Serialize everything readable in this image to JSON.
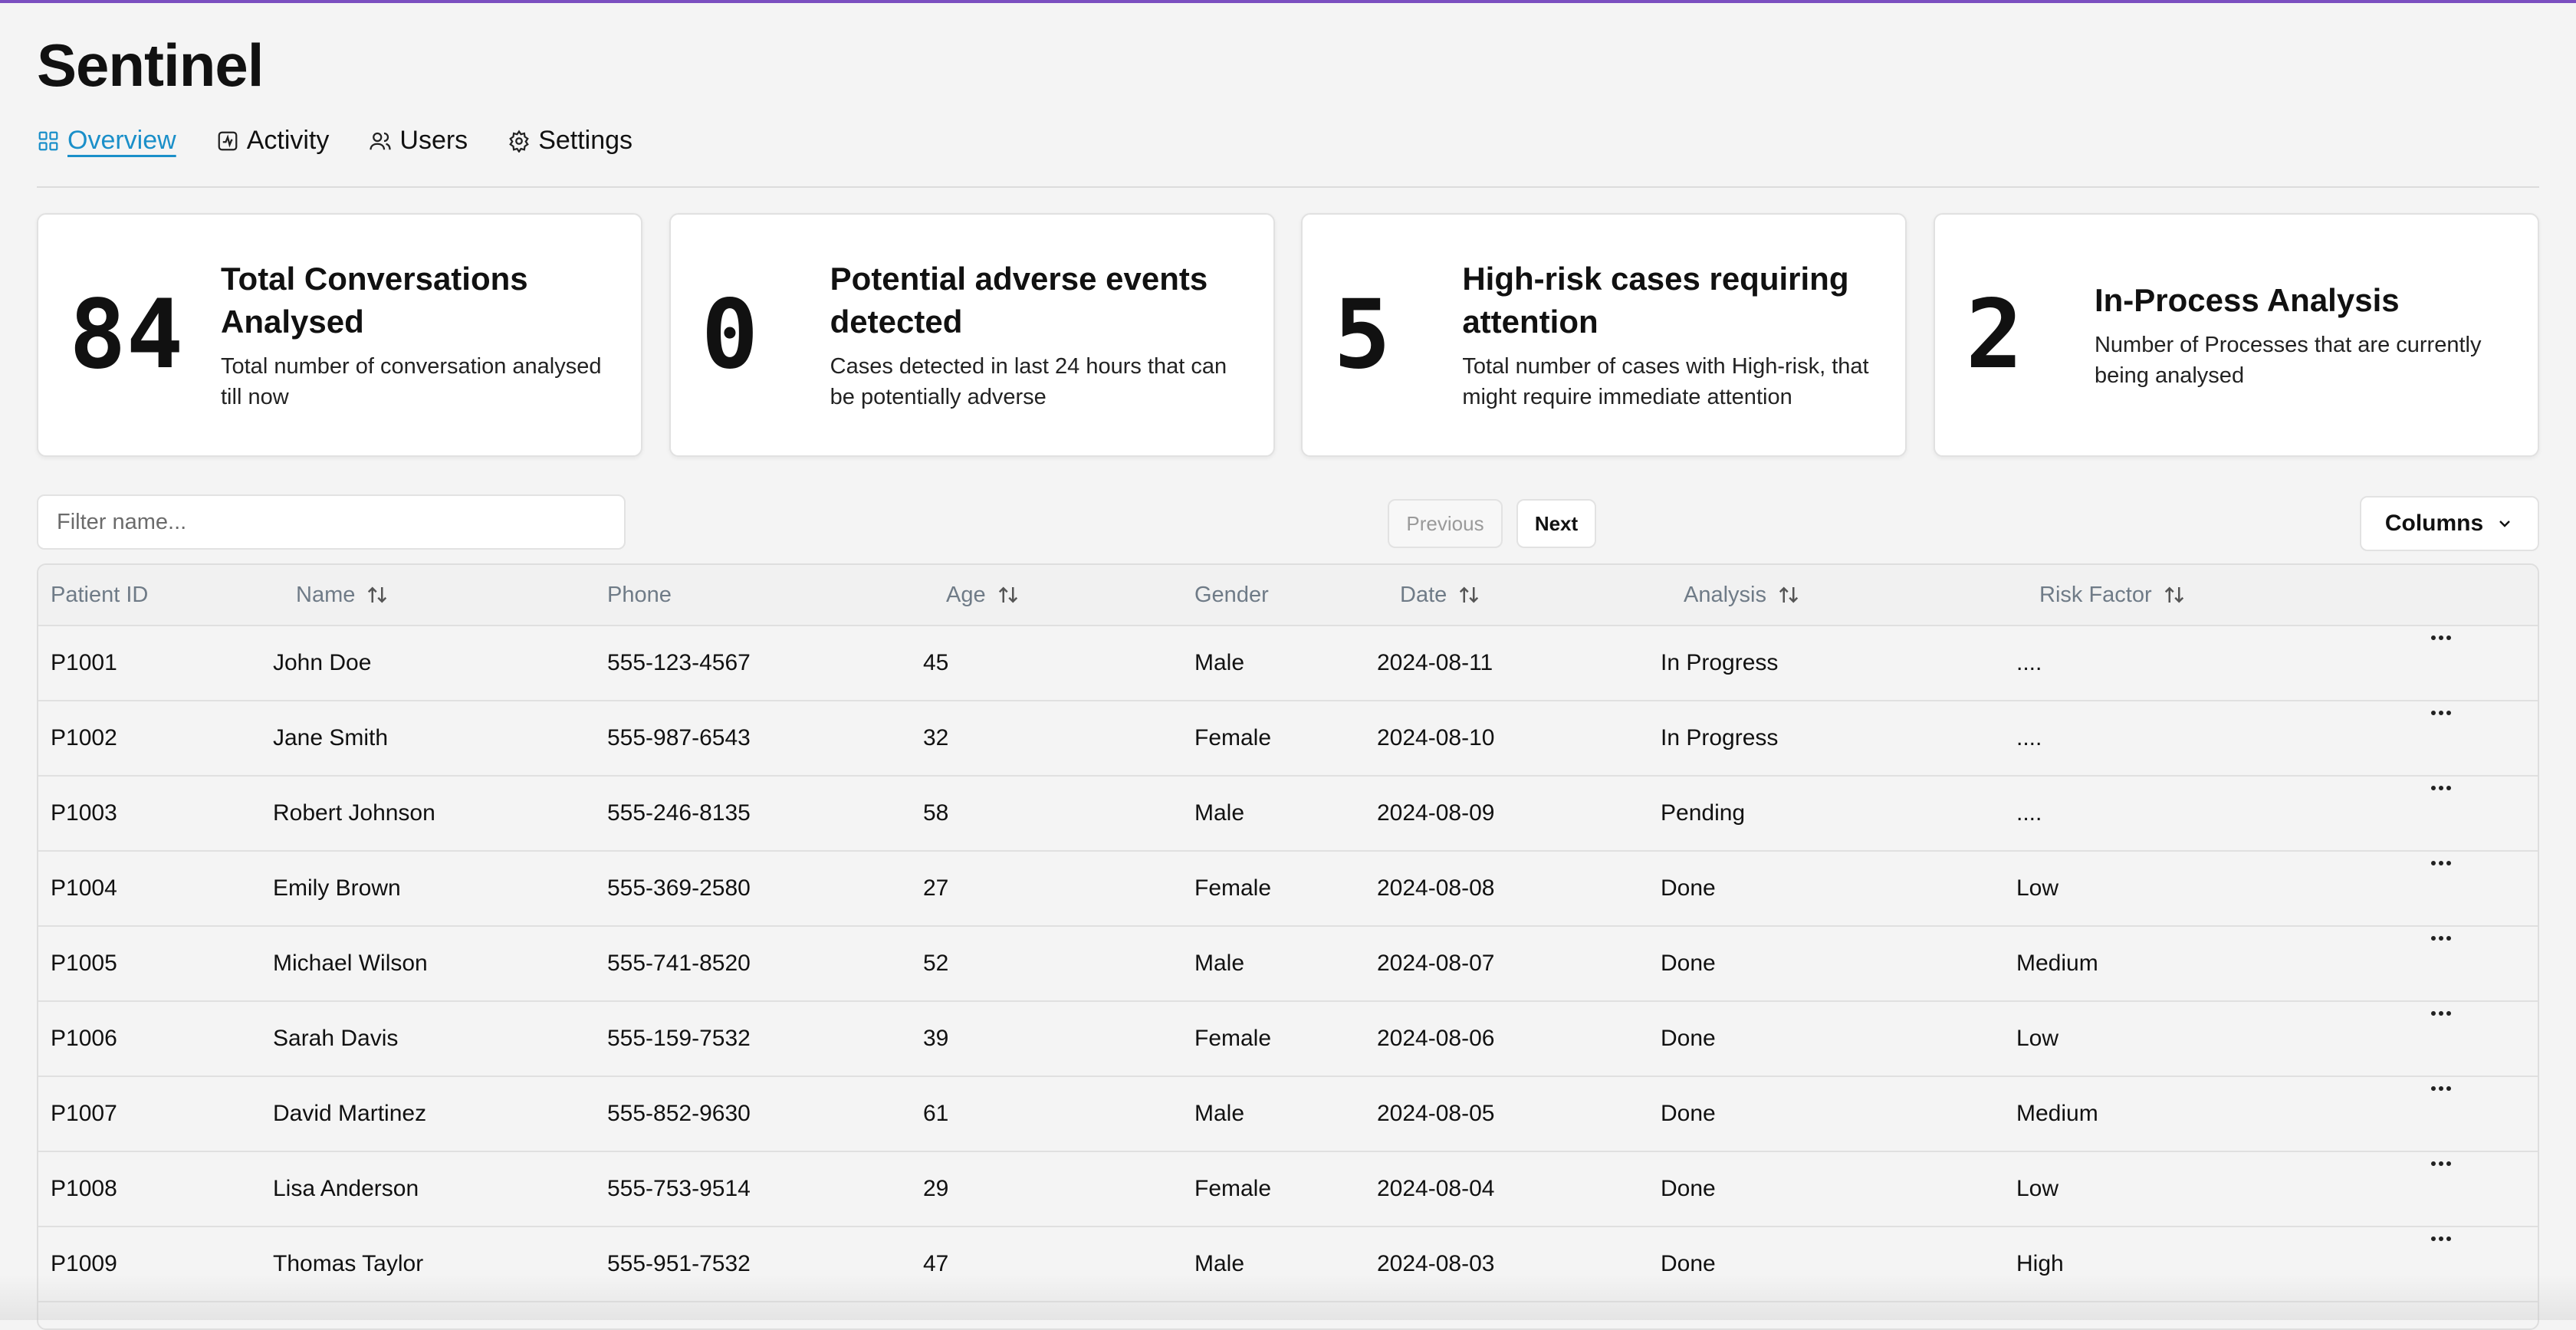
{
  "app": {
    "title": "Sentinel",
    "accent_color": "#1a8fc9",
    "top_bar_color": "#7b4fc0"
  },
  "tabs": [
    {
      "label": "Overview",
      "icon": "grid-icon",
      "active": true
    },
    {
      "label": "Activity",
      "icon": "activity-icon",
      "active": false
    },
    {
      "label": "Users",
      "icon": "users-icon",
      "active": false
    },
    {
      "label": "Settings",
      "icon": "gear-icon",
      "active": false
    }
  ],
  "cards": [
    {
      "value": "84",
      "title": "Total Conversations Analysed",
      "desc": "Total number of conversation analysed till now"
    },
    {
      "value": "0",
      "title": "Potential adverse events detected",
      "desc": "Cases detected in last 24 hours that can be potentially adverse"
    },
    {
      "value": "5",
      "title": "High-risk cases requiring attention",
      "desc": "Total number of cases with High-risk, that might require immediate attention"
    },
    {
      "value": "2",
      "title": "In-Process Analysis",
      "desc": "Number of Processes that are currently being analysed"
    }
  ],
  "filter": {
    "placeholder": "Filter name...",
    "value": ""
  },
  "pagination": {
    "previous_label": "Previous",
    "next_label": "Next"
  },
  "columns_button": {
    "label": "Columns",
    "icon": "chevron-down-icon"
  },
  "table": {
    "headers": [
      "Patient ID",
      "Name",
      "Phone",
      "Age",
      "Gender",
      "Date",
      "Analysis",
      "Risk Factor"
    ],
    "sortable": [
      false,
      true,
      false,
      true,
      false,
      true,
      true,
      true
    ],
    "rows": [
      [
        "P1001",
        "John Doe",
        "555-123-4567",
        "45",
        "Male",
        "2024-08-11",
        "In Progress",
        "...."
      ],
      [
        "P1002",
        "Jane Smith",
        "555-987-6543",
        "32",
        "Female",
        "2024-08-10",
        "In Progress",
        "...."
      ],
      [
        "P1003",
        "Robert Johnson",
        "555-246-8135",
        "58",
        "Male",
        "2024-08-09",
        "Pending",
        "...."
      ],
      [
        "P1004",
        "Emily Brown",
        "555-369-2580",
        "27",
        "Female",
        "2024-08-08",
        "Done",
        "Low"
      ],
      [
        "P1005",
        "Michael Wilson",
        "555-741-8520",
        "52",
        "Male",
        "2024-08-07",
        "Done",
        "Medium"
      ],
      [
        "P1006",
        "Sarah Davis",
        "555-159-7532",
        "39",
        "Female",
        "2024-08-06",
        "Done",
        "Low"
      ],
      [
        "P1007",
        "David Martinez",
        "555-852-9630",
        "61",
        "Male",
        "2024-08-05",
        "Done",
        "Medium"
      ],
      [
        "P1008",
        "Lisa Anderson",
        "555-753-9514",
        "29",
        "Female",
        "2024-08-04",
        "Done",
        "Low"
      ],
      [
        "P1009",
        "Thomas Taylor",
        "555-951-7532",
        "47",
        "Male",
        "2024-08-03",
        "Done",
        "High"
      ]
    ],
    "row_action_icon": "more-horizontal-icon"
  }
}
